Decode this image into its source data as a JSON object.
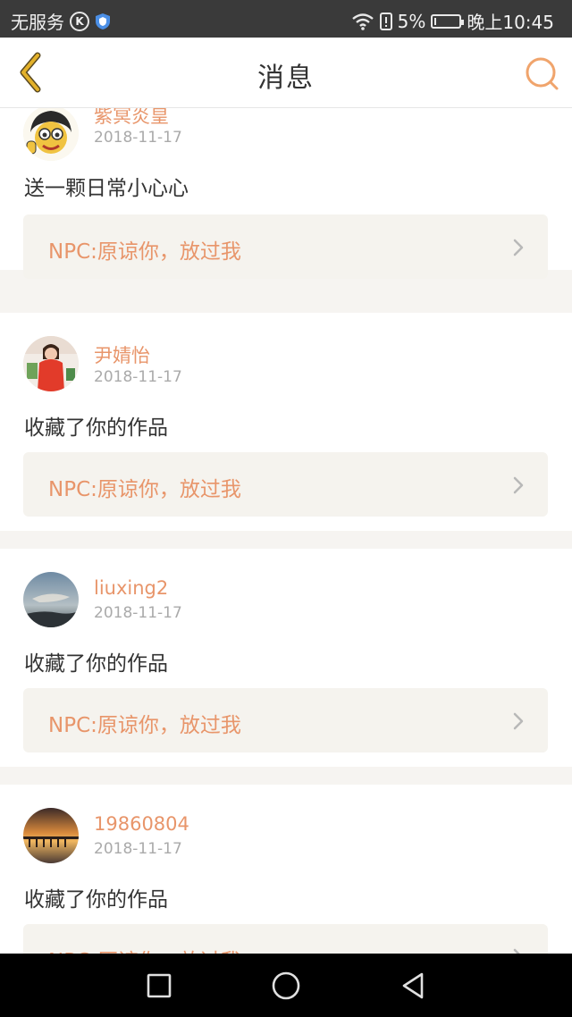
{
  "status_bar": {
    "carrier": "无服务",
    "battery_percent": "5%",
    "battery_level": 0.05,
    "time": "晚上10:45"
  },
  "header": {
    "title": "消息"
  },
  "colors": {
    "accent": "#e8956a",
    "back_arrow": "#e3b12a",
    "npc_box": "#f5f3ee"
  },
  "notifications": [
    {
      "username": "紫冥炎皇",
      "date": "2018-11-17",
      "message": "送一颗日常小心心",
      "work": "NPC:原谅你，放过我"
    },
    {
      "username": "尹婧怡",
      "date": "2018-11-17",
      "message": "收藏了你的作品",
      "work": "NPC:原谅你，放过我"
    },
    {
      "username": "liuxing2",
      "date": "2018-11-17",
      "message": "收藏了你的作品",
      "work": "NPC:原谅你，放过我"
    },
    {
      "username": "19860804",
      "date": "2018-11-17",
      "message": "收藏了你的作品",
      "work": "NPC:原谅你，放过我"
    }
  ],
  "nav": {
    "icons": [
      "recents-square-icon",
      "home-circle-icon",
      "back-triangle-icon"
    ]
  }
}
